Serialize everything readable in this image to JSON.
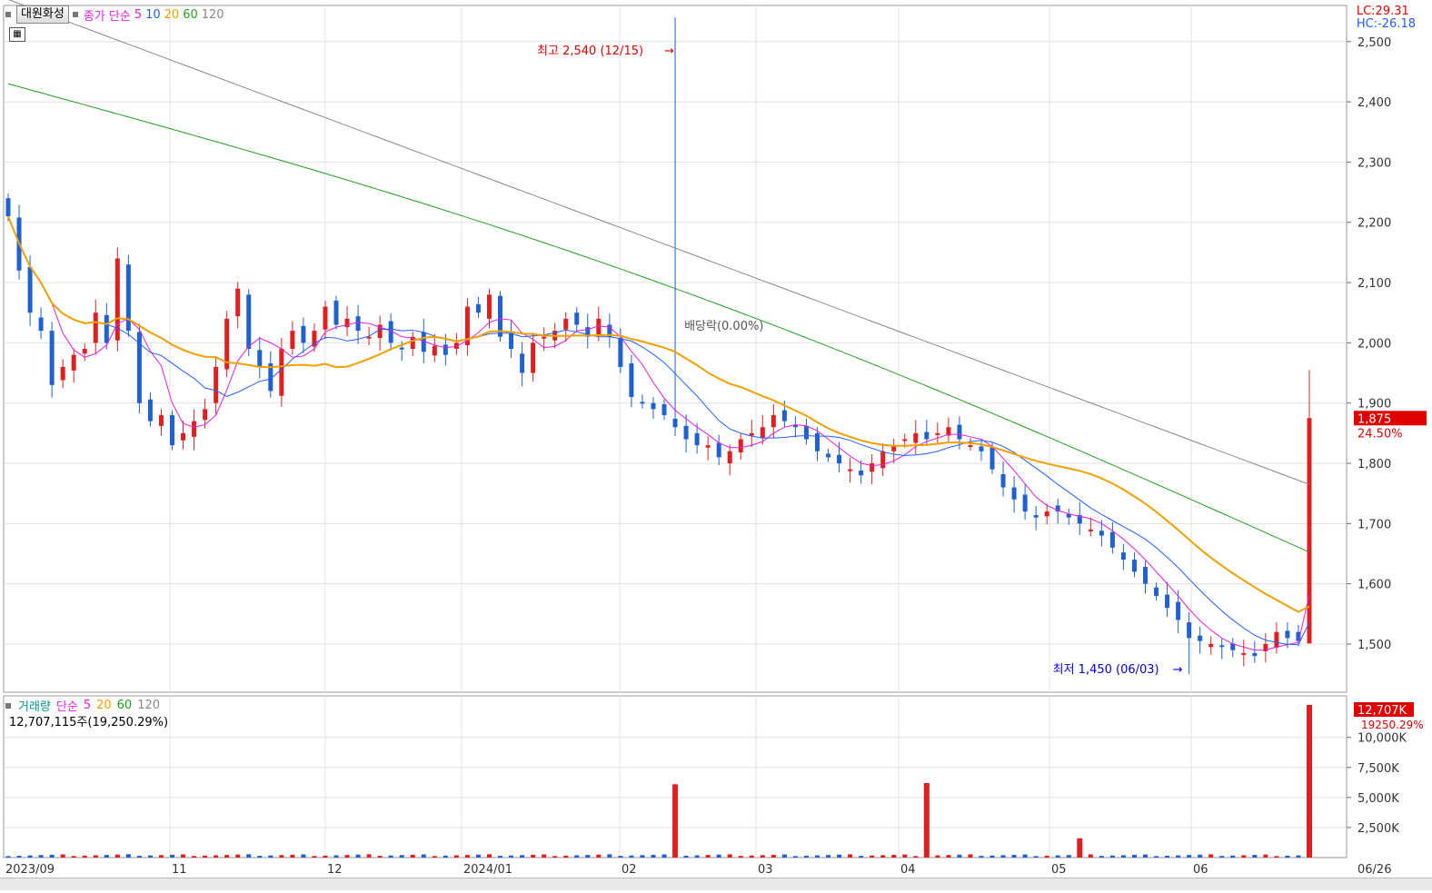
{
  "header": {
    "stock_name": "대원화성",
    "price_label": "종가 단순",
    "ma_periods": [
      "5",
      "10",
      "20",
      "60",
      "120"
    ],
    "ma_colors": [
      "#e020e0",
      "#2060ff",
      "#f0a000",
      "#20a020",
      "#888888"
    ]
  },
  "info": {
    "lc": "LC:29.31",
    "hc": "HC:-26.18"
  },
  "price_axis": {
    "ticks": [
      "2,500",
      "2,400",
      "2,300",
      "2,200",
      "2,100",
      "2,000",
      "1,900",
      "1,800",
      "1,700",
      "1,600",
      "1,500"
    ]
  },
  "last_price": {
    "value": "1,875",
    "change": "24.50%"
  },
  "annotations": {
    "high": "최고 2,540 (12/15)",
    "low": "최저 1,450 (06/03)",
    "ex_dividend": "배당락(0.00%)"
  },
  "volume_header": {
    "label": "거래량",
    "ma_label": "단순",
    "ma_periods": [
      "5",
      "20",
      "60",
      "120"
    ],
    "info": "12,707,115주(19,250.29%)"
  },
  "volume_axis": {
    "ticks": [
      "10,000K",
      "7,500K",
      "5,000K",
      "2,500K"
    ]
  },
  "last_volume": {
    "value": "12,707K",
    "pct": "19250.29%"
  },
  "x_axis": {
    "labels": [
      "2023/09",
      "11",
      "12",
      "2024/01",
      "02",
      "03",
      "04",
      "05",
      "06",
      "06/26"
    ]
  },
  "chart_data": {
    "type": "candlestick",
    "y_range": [
      1420,
      2560
    ],
    "volume_range_k": [
      0,
      13000
    ],
    "high": 2540,
    "low": 1450,
    "last_close": 1875,
    "last_volume_k": 12707,
    "volume_spikes_k": [
      {
        "period": "2023/12",
        "value": 6100
      },
      {
        "period": "2024/03",
        "value": 6200
      },
      {
        "period": "2024/04",
        "value": 1600
      },
      {
        "period": "2024/06",
        "value": 12707
      }
    ],
    "ma_end_values": {
      "5": 1580,
      "10": 1540,
      "20": 1525,
      "60": 1650,
      "120": 1765
    },
    "closes": [
      2210,
      2120,
      2050,
      2020,
      1930,
      1960,
      1980,
      1990,
      2050,
      2000,
      2140,
      2020,
      1900,
      1870,
      1880,
      1830,
      1850,
      1870,
      1890,
      1960,
      2040,
      2090,
      1990,
      1960,
      1920,
      1990,
      2020,
      2000,
      2020,
      2060,
      2030,
      2040,
      2020,
      2010,
      2030,
      2000,
      1990,
      2010,
      1985,
      1995,
      1980,
      2000,
      2060,
      2050,
      2080,
      2010,
      1990,
      1950,
      2000,
      2010,
      2020,
      2040,
      2030,
      2010,
      2040,
      2010,
      1960,
      1910,
      1900,
      1890,
      1880,
      1860,
      1840,
      1830,
      1830,
      1810,
      1820,
      1840,
      1850,
      1860,
      1880,
      1870,
      1860,
      1840,
      1820,
      1810,
      1800,
      1790,
      1780,
      1800,
      1820,
      1830,
      1840,
      1850,
      1840,
      1850,
      1860,
      1840,
      1830,
      1820,
      1790,
      1760,
      1740,
      1720,
      1710,
      1720,
      1720,
      1710,
      1700,
      1690,
      1680,
      1660,
      1640,
      1620,
      1600,
      1580,
      1560,
      1540,
      1510,
      1505,
      1500,
      1495,
      1490,
      1485,
      1480,
      1500,
      1520,
      1510,
      1505,
      1875
    ]
  }
}
